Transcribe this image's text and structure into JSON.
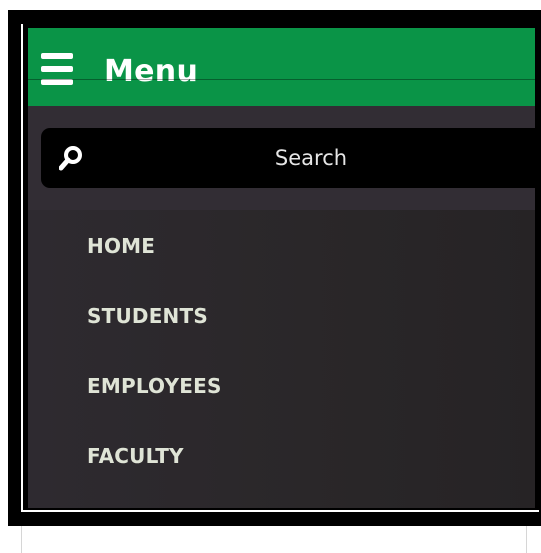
{
  "header": {
    "title": "Menu",
    "icon": "hamburger-menu-icon",
    "background_color": "#0a9447"
  },
  "search": {
    "label": "Search",
    "icon": "search-icon"
  },
  "nav": {
    "items": [
      {
        "label": "HOME"
      },
      {
        "label": "STUDENTS"
      },
      {
        "label": "EMPLOYEES"
      },
      {
        "label": "FACULTY"
      }
    ]
  },
  "colors": {
    "panel": "#2a2729",
    "accent_green": "#0a9447",
    "text_nav": "#dfe4d6"
  }
}
